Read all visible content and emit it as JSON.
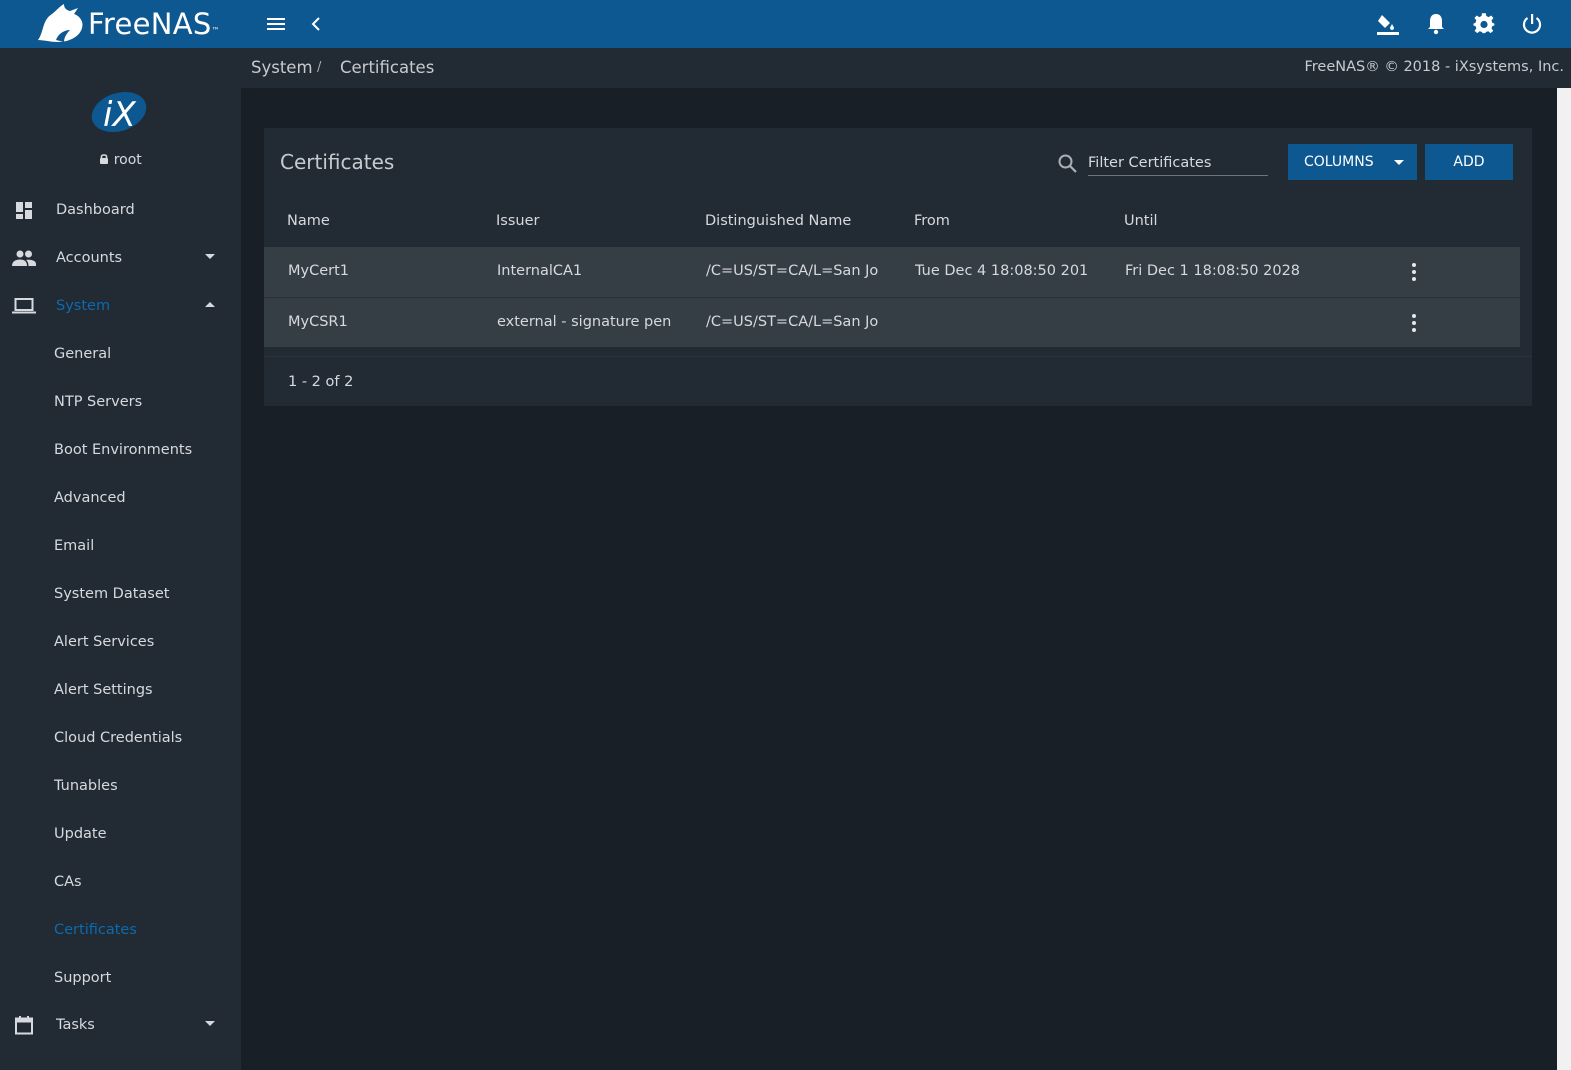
{
  "app": {
    "brand": "FreeNAS",
    "brand_tm": "™",
    "copyright": "FreeNAS® © 2018 - iXsystems, Inc.",
    "accent": "#0d5891",
    "active_color": "#0d6aaf"
  },
  "topbar": {
    "icons": [
      "menu-icon",
      "chevron-left-icon",
      "paint-bucket-icon",
      "bell-icon",
      "gear-icon",
      "power-icon"
    ]
  },
  "sidebar": {
    "logo_text": "iX",
    "user": "root",
    "items": [
      {
        "label": "Dashboard",
        "icon": "dashboard-icon"
      },
      {
        "label": "Accounts",
        "icon": "people-icon"
      },
      {
        "label": "System",
        "icon": "laptop-icon"
      },
      {
        "label": "Tasks",
        "icon": "calendar-icon"
      }
    ],
    "system_sub": [
      {
        "label": "General"
      },
      {
        "label": "NTP Servers"
      },
      {
        "label": "Boot Environments"
      },
      {
        "label": "Advanced"
      },
      {
        "label": "Email"
      },
      {
        "label": "System Dataset"
      },
      {
        "label": "Alert Services"
      },
      {
        "label": "Alert Settings"
      },
      {
        "label": "Cloud Credentials"
      },
      {
        "label": "Tunables"
      },
      {
        "label": "Update"
      },
      {
        "label": "CAs"
      },
      {
        "label": "Certificates"
      },
      {
        "label": "Support"
      }
    ]
  },
  "breadcrumb": {
    "parent": "System",
    "separator": "/",
    "current": "Certificates"
  },
  "card": {
    "title": "Certificates",
    "filter_placeholder": "Filter Certificates",
    "columns_label": "COLUMNS",
    "add_label": "ADD",
    "headers": [
      "Name",
      "Issuer",
      "Distinguished Name",
      "From",
      "Until"
    ],
    "rows": [
      {
        "name": "MyCert1",
        "issuer": "InternalCA1",
        "dn": "/C=US/ST=CA/L=San Jo",
        "from": "Tue Dec 4 18:08:50 201",
        "until": "Fri Dec 1 18:08:50 2028"
      },
      {
        "name": "MyCSR1",
        "issuer": "external - signature pen",
        "dn": "/C=US/ST=CA/L=San Jo",
        "from": "",
        "until": ""
      }
    ],
    "pager": "1 - 2 of 2"
  }
}
